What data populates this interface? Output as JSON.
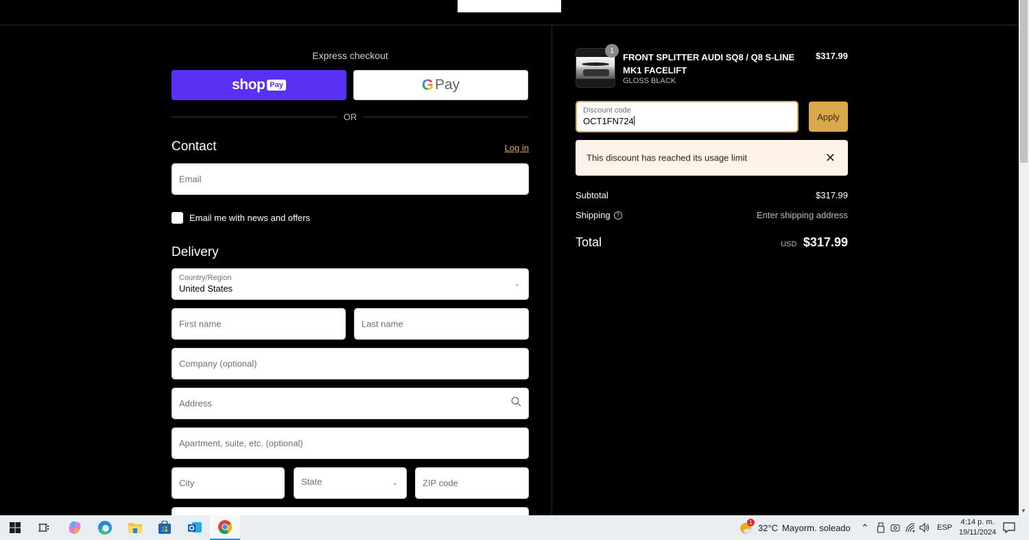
{
  "express_checkout": {
    "label": "Express checkout",
    "shop_pay": {
      "word": "shop",
      "badge": "Pay"
    },
    "google_pay": {
      "letter": "G",
      "word": "Pay"
    },
    "or_label": "OR"
  },
  "contact": {
    "title": "Contact",
    "login_link": "Log in",
    "email_placeholder": "Email",
    "newsletter_label": "Email me with news and offers",
    "newsletter_checked": false
  },
  "delivery": {
    "title": "Delivery",
    "country": {
      "label": "Country/Region",
      "value": "United States"
    },
    "first_name_placeholder": "First name",
    "last_name_placeholder": "Last name",
    "company_placeholder": "Company (optional)",
    "address_placeholder": "Address",
    "apartment_placeholder": "Apartment, suite, etc. (optional)",
    "city_placeholder": "City",
    "state_placeholder": "State",
    "zip_placeholder": "ZIP code"
  },
  "order_summary": {
    "product": {
      "quantity": "1",
      "title": "FRONT SPLITTER AUDI SQ8 / Q8 S-LINE MK1 FACELIFT",
      "variant": "GLOSS BLACK",
      "price": "$317.99"
    },
    "discount": {
      "label": "Discount code",
      "value": "OCT1FN724",
      "apply_label": "Apply",
      "error": "This discount has reached its usage limit"
    },
    "subtotal_label": "Subtotal",
    "subtotal_value": "$317.99",
    "shipping_label": "Shipping",
    "shipping_value": "Enter shipping address",
    "total_label": "Total",
    "total_currency": "USD",
    "total_value": "$317.99"
  },
  "taskbar": {
    "apps": [
      "start",
      "task-view",
      "copilot",
      "edge",
      "file-explorer",
      "microsoft-store",
      "outlook",
      "chrome"
    ],
    "active_app": "chrome",
    "weather_badge": "1",
    "weather_temp": "32°C",
    "weather_desc": "Mayorm. soleado",
    "language": "ESP",
    "time": "4:14 p. m.",
    "date": "19/11/2024"
  },
  "colors": {
    "accent": "#d9a84a",
    "shop_pay": "#5a31f4",
    "alert_bg": "#fdf3e8",
    "background": "#000000"
  }
}
